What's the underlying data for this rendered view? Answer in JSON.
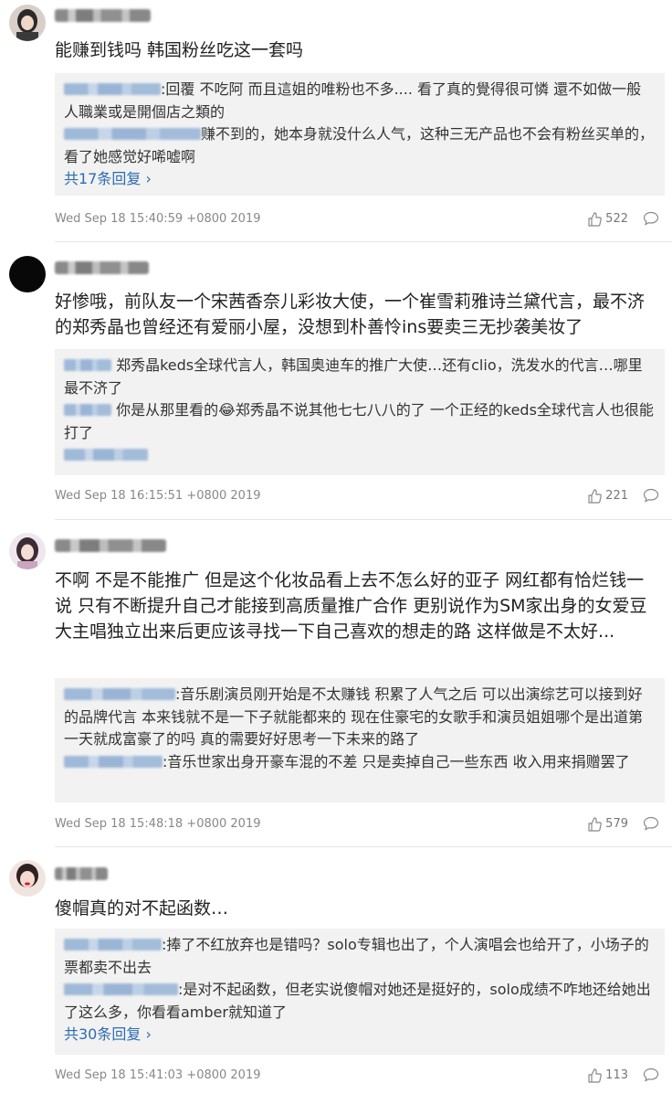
{
  "comments": [
    {
      "text": "能赚到钱吗 韩国粉丝吃这一套吗",
      "replies": [
        {
          "text": ":回覆                              不吃阿 而且這姐的唯粉也不多.... 看了真的覺得很可憐 還不如做一般人職業或是開個店之類的"
        },
        {
          "text": "赚不到的，她本身就没什么人气，这种三无产品也不会有粉丝买单的，看了她感觉好唏嘘啊"
        }
      ],
      "more": "共17条回复",
      "time": "Wed Sep 18 15:40:59 +0800 2019",
      "likes": "522"
    },
    {
      "text": "好惨哦，前队友一个宋茜香奈儿彩妆大使，一个崔雪莉雅诗兰黛代言，最不济的郑秀晶也曾经还有爱丽小屋，没想到朴善怜ins要卖三无抄袭美妆了",
      "replies": [
        {
          "text": "郑秀晶keds全球代言人，韩国奥迪车的推广大使…还有clio，洗发水的代言…哪里最不济了"
        },
        {
          "text": "你是从那里看的😂郑秀晶不说其他七七八八的了 一个正经的keds全球代言人也很能打了"
        }
      ],
      "more": "",
      "time": "Wed Sep 18 16:15:51 +0800 2019",
      "likes": "221"
    },
    {
      "text": "不啊 不是不能推广 但是这个化妆品看上去不怎么好的亚子 网红都有恰烂钱一说 只有不断提升自己才能接到高质量推广合作 更别说作为SM家出身的女爱豆大主唱独立出来后更应该寻找一下自己喜欢的想走的路 这样做是不太好...",
      "replies": [
        {
          "text": ":音乐剧演员刚开始是不太赚钱 积累了人气之后 可以出演综艺可以接到好的品牌代言 本来钱就不是一下子就能都来的 现在住豪宅的女歌手和演员姐姐哪个是出道第一天就成富豪了的吗 真的需要好好思考一下未来的路了"
        },
        {
          "text": ":音乐世家出身开豪车混的不差 只是卖掉自己一些东西 收入用来捐赠罢了"
        }
      ],
      "more": "",
      "time": "Wed Sep 18 15:48:18 +0800 2019",
      "likes": "579"
    },
    {
      "text": "傻帽真的对不起函数…",
      "replies": [
        {
          "text": ":捧了不红放弃也是错吗？solo专辑也出了，个人演唱会也给开了，小场子的票都卖不出去"
        },
        {
          "text": ":是对不起函数，但老实说傻帽对她还是挺好的，solo成绩不咋地还给她出了这么多，你看看amber就知道了"
        }
      ],
      "more": "共30条回复",
      "time": "Wed Sep 18 15:41:03 +0800 2019",
      "likes": "113"
    }
  ],
  "colors": {
    "link": "#2d6bb3",
    "reply_bg": "#f2f2f2",
    "meta": "#888888"
  },
  "icons": {
    "like": "thumbs-up-icon",
    "comment": "speech-bubble-icon",
    "more_arrow": "chevron-right-icon"
  }
}
